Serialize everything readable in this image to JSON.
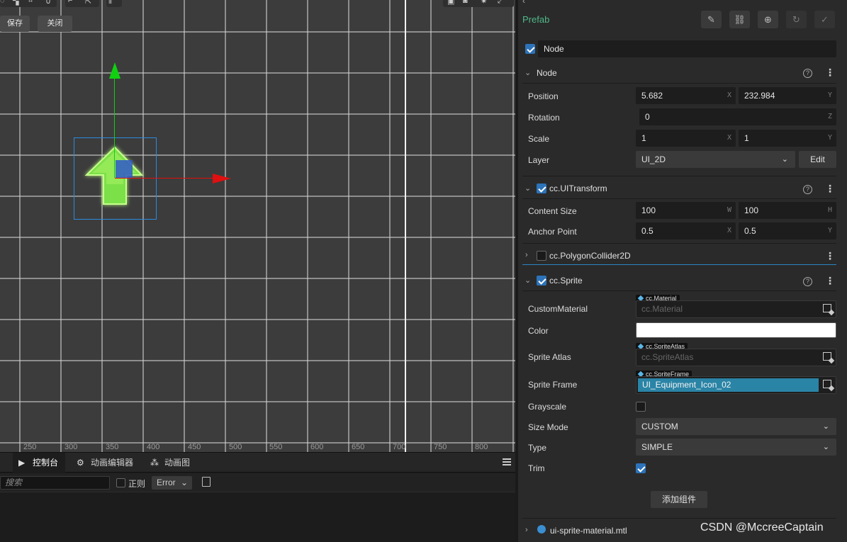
{
  "scene": {
    "save_label": "保存",
    "close_label": "关闭",
    "ruler_ticks": [
      "250",
      "300",
      "350",
      "400",
      "450",
      "500",
      "550",
      "600",
      "650",
      "700",
      "750",
      "800"
    ]
  },
  "bottom": {
    "tabs": [
      {
        "label": "控制台",
        "icon": "terminal-icon",
        "active": true
      },
      {
        "label": "动画编辑器",
        "icon": "running-figure-icon",
        "active": false
      },
      {
        "label": "动画图",
        "icon": "graph-icon",
        "active": false
      }
    ],
    "search_placeholder": "搜索",
    "regex_label": "正则",
    "level_value": "Error"
  },
  "inspector": {
    "prefab_label": "Prefab",
    "node_name": "Node",
    "node_section": {
      "title": "Node",
      "position_label": "Position",
      "position_x": "5.682",
      "position_y": "232.984",
      "rotation_label": "Rotation",
      "rotation_z": "0",
      "scale_label": "Scale",
      "scale_x": "1",
      "scale_y": "1",
      "layer_label": "Layer",
      "layer_value": "UI_2D",
      "edit_label": "Edit"
    },
    "transform_section": {
      "title": "cc.UITransform",
      "content_size_label": "Content Size",
      "width": "100",
      "height": "100",
      "anchor_label": "Anchor Point",
      "anchor_x": "0.5",
      "anchor_y": "0.5"
    },
    "collider_section": {
      "title": "cc.PolygonCollider2D"
    },
    "sprite_section": {
      "title": "cc.Sprite",
      "custom_material_label": "CustomMaterial",
      "custom_material_tag": "cc.Material",
      "custom_material_placeholder": "cc.Material",
      "color_label": "Color",
      "color_value": "#ffffff",
      "atlas_label": "Sprite Atlas",
      "atlas_tag": "cc.SpriteAtlas",
      "atlas_placeholder": "cc.SpriteAtlas",
      "frame_label": "Sprite Frame",
      "frame_tag": "cc.SpriteFrame",
      "frame_value": "UI_Equipment_Icon_02",
      "grayscale_label": "Grayscale",
      "size_mode_label": "Size Mode",
      "size_mode_value": "CUSTOM",
      "type_label": "Type",
      "type_value": "SIMPLE",
      "trim_label": "Trim"
    },
    "add_component_label": "添加组件",
    "material_asset": "ui-sprite-material.mtl",
    "watermark": "CSDN @MccreeCaptain",
    "axis_letters": {
      "x": "X",
      "y": "Y",
      "z": "Z",
      "w": "W",
      "h": "H"
    }
  },
  "colors": {
    "accent": "#2d73b9",
    "prefab_green": "#4fb88a",
    "sprite_frame_highlight": "#2a84a6"
  }
}
